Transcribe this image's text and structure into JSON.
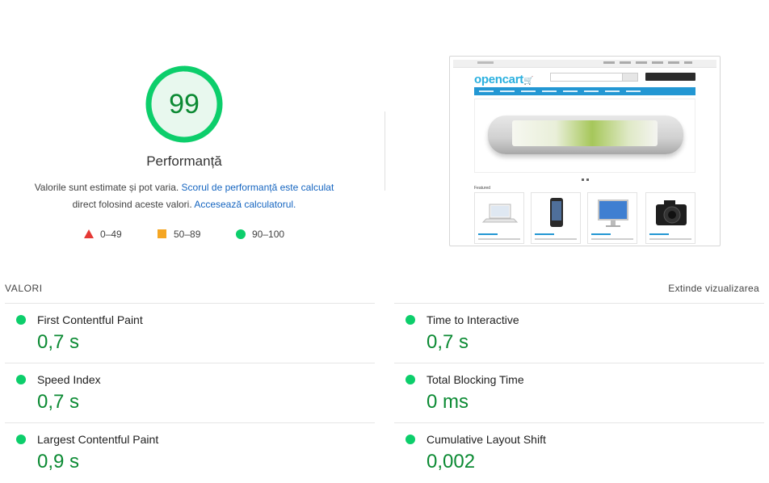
{
  "summary": {
    "score": "99",
    "score_fraction": 0.99,
    "title": "Performanță",
    "desc_prefix": "Valorile sunt estimate și pot varia. ",
    "desc_link1": "Scorul de performanță este calculat",
    "desc_middle": " direct folosind aceste valori. ",
    "desc_link2": "Accesează calculatorul.",
    "legend": [
      {
        "shape": "triangle",
        "label": "0–49",
        "color": "#e53935"
      },
      {
        "shape": "square",
        "label": "50–89",
        "color": "#f5a623"
      },
      {
        "shape": "circle",
        "label": "90–100",
        "color": "#0cce6b"
      }
    ]
  },
  "thumbnail": {
    "logo": "opencart",
    "featured": "Featured"
  },
  "metrics_header": {
    "label": "VALORI",
    "expand": "Extinde vizualizarea"
  },
  "metrics": [
    {
      "name": "First Contentful Paint",
      "value": "0,7 s"
    },
    {
      "name": "Time to Interactive",
      "value": "0,7 s"
    },
    {
      "name": "Speed Index",
      "value": "0,7 s"
    },
    {
      "name": "Total Blocking Time",
      "value": "0 ms"
    },
    {
      "name": "Largest Contentful Paint",
      "value": "0,9 s"
    },
    {
      "name": "Cumulative Layout Shift",
      "value": "0,002"
    }
  ],
  "colors": {
    "pass": "#0cce6b",
    "pass_text": "#0b8a33",
    "link": "#1565c0"
  }
}
